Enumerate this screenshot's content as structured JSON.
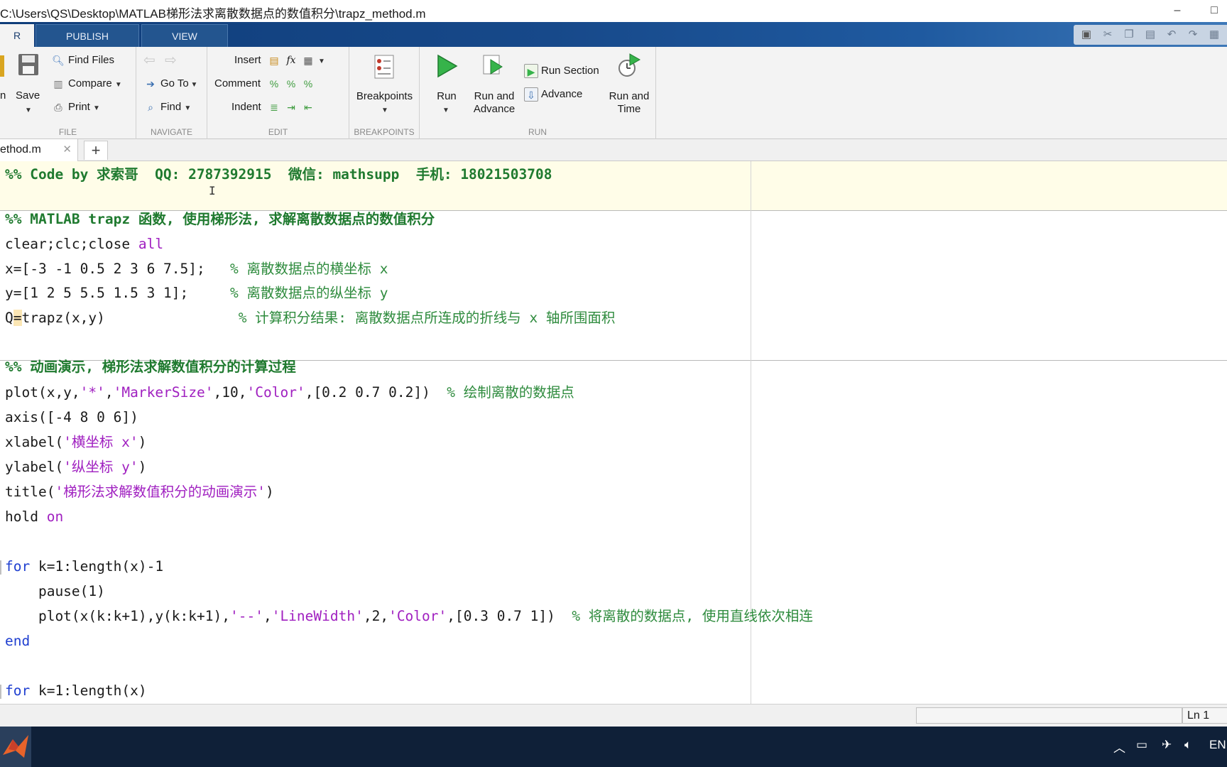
{
  "window": {
    "title": "C:\\Users\\QS\\Desktop\\MATLAB梯形法求离散数据点的数值积分\\trapz_method.m",
    "minimize": "–",
    "maximize": "□"
  },
  "ribbon_tabs": [
    {
      "label": "R"
    },
    {
      "label": "PUBLISH"
    },
    {
      "label": "VIEW"
    }
  ],
  "file_group": {
    "open_label": "n",
    "save_label": "Save",
    "find_files_label": "Find Files",
    "compare_label": "Compare",
    "print_label": "Print",
    "group_label": "FILE"
  },
  "navigate_group": {
    "goto_label": "Go To",
    "find_label": "Find",
    "group_label": "NAVIGATE"
  },
  "edit_group": {
    "insert_label": "Insert",
    "comment_label": "Comment",
    "indent_label": "Indent",
    "group_label": "EDIT"
  },
  "breakpoints_group": {
    "breakpoints_label": "Breakpoints",
    "group_label": "BREAKPOINTS"
  },
  "run_group": {
    "run_label": "Run",
    "run_advance_label_1": "Run and",
    "run_advance_label_2": "Advance",
    "run_section_label": "Run Section",
    "advance_label": "Advance",
    "run_time_label_1": "Run and",
    "run_time_label_2": "Time",
    "group_label": "RUN"
  },
  "file_tab": {
    "name": "ethod.m",
    "close": "✕",
    "add": "+"
  },
  "code": {
    "l1": "%% Code by 求索哥  QQ: 2787392915  微信: mathsupp  手机: 18021503708",
    "l2_hdr": "%% MATLAB trapz 函数, 使用梯形法, 求解离散数据点的数值积分",
    "l3_a": "clear;clc;close ",
    "l3_b": "all",
    "l4_a": "x=[-3 -1 0.5 2 3 6 7.5];   ",
    "l4_c": "% 离散数据点的横坐标 x",
    "l5_a": "y=[1 2 5 5.5 1.5 3 1];     ",
    "l5_c": "% 离散数据点的纵坐标 y",
    "l6_a": "Q",
    "l6_b": "=",
    "l6_c": "trapz(x,y)                ",
    "l6_d": "% 计算积分结果: 离散数据点所连成的折线与 x 轴所围面积",
    "l7_hdr": "%% 动画演示, 梯形法求解数值积分的计算过程",
    "l8_a": "plot(x,y,",
    "l8_s1": "'*'",
    "l8_b": ",",
    "l8_s2": "'MarkerSize'",
    "l8_c": ",10,",
    "l8_s3": "'Color'",
    "l8_d": ",[0.2 0.7 0.2])  ",
    "l8_cm": "% 绘制离散的数据点",
    "l9": "axis([-4 8 0 6])",
    "l10_a": "xlabel(",
    "l10_s": "'横坐标 x'",
    "l10_b": ")",
    "l11_a": "ylabel(",
    "l11_s": "'纵坐标 y'",
    "l11_b": ")",
    "l12_a": "title(",
    "l12_s": "'梯形法求解数值积分的动画演示'",
    "l12_b": ")",
    "l13_a": "hold ",
    "l13_b": "on",
    "l14_kw": "for",
    "l14_a": " k=1:length(x)-1",
    "l15": "    pause(1)",
    "l16_a": "    plot(x(k:k+1),y(k:k+1),",
    "l16_s1": "'--'",
    "l16_b": ",",
    "l16_s2": "'LineWidth'",
    "l16_c": ",2,",
    "l16_s3": "'Color'",
    "l16_d": ",[0.3 0.7 1])  ",
    "l16_cm": "% 将离散的数据点, 使用直线依次相连",
    "l17_kw": "end",
    "l18_kw": "for",
    "l18_a": " k=1:length(x)"
  },
  "status": {
    "ln_label": "Ln  1"
  },
  "taskbar": {
    "lang": "EN"
  }
}
